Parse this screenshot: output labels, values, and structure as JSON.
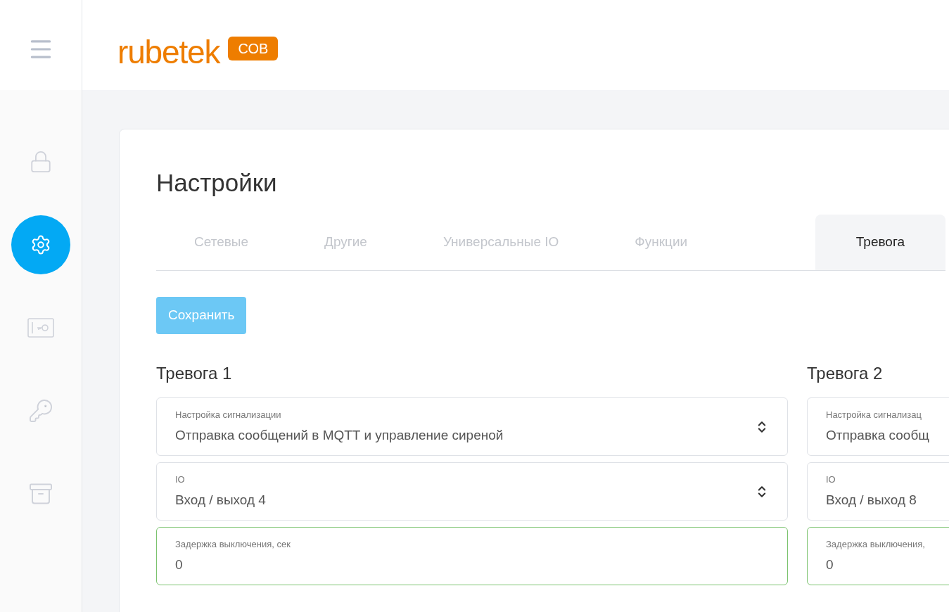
{
  "header": {
    "logo": "rubetek",
    "badge": "СОВ"
  },
  "sidebar": {
    "items": [
      {
        "kind": "lock",
        "selected": false
      },
      {
        "kind": "gear",
        "selected": true
      },
      {
        "kind": "card",
        "selected": false
      },
      {
        "kind": "key",
        "selected": false
      },
      {
        "kind": "archive",
        "selected": false
      }
    ]
  },
  "page": {
    "title": "Настройки"
  },
  "tabs": [
    {
      "label": "Сетевые",
      "selected": false
    },
    {
      "label": "Другие",
      "selected": false
    },
    {
      "label": "Универсальные IO",
      "selected": false
    },
    {
      "label": "Функции",
      "selected": false
    },
    {
      "label": "Тревога",
      "selected": true
    }
  ],
  "save_button": {
    "label": "Сохранить",
    "disabled": true
  },
  "alarms": [
    {
      "title": "Тревога 1",
      "fields": [
        {
          "kind": "select",
          "label": "Настройка сигнализации",
          "value": "Отправка сообщений в MQTT и управление сиреной",
          "valid": false
        },
        {
          "kind": "select",
          "label": "IO",
          "value": "Вход / выход 4",
          "valid": false
        },
        {
          "kind": "input",
          "label": "Задержка выключения, сек",
          "value": "0",
          "valid": true
        }
      ]
    },
    {
      "title": "Тревога 2",
      "fields": [
        {
          "kind": "select",
          "label": "Настройка сигнализац",
          "value": "Отправка сообщ",
          "valid": false
        },
        {
          "kind": "select",
          "label": "IO",
          "value": "Вход / выход 8",
          "valid": false
        },
        {
          "kind": "input",
          "label": "Задержка выключения,",
          "value": "0",
          "valid": true
        }
      ]
    }
  ]
}
